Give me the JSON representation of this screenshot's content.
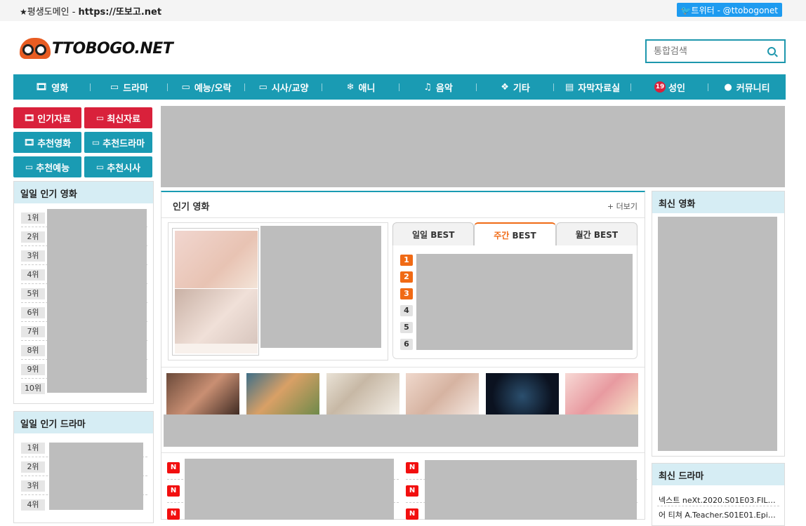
{
  "topbar": {
    "domain_label": "평생도메인 - ",
    "domain_url": "https://또보고.net",
    "twitter": "트위터 - @ttobogonet"
  },
  "header": {
    "logo_text": "TTOBOGO.NET",
    "search_placeholder": "통합검색"
  },
  "nav": {
    "items": [
      {
        "label": "영화",
        "icon": "film-icon"
      },
      {
        "label": "드라마",
        "icon": "monitor-icon"
      },
      {
        "label": "예능/오락",
        "icon": "monitor-icon"
      },
      {
        "label": "시사/교양",
        "icon": "monitor-icon"
      },
      {
        "label": "애니",
        "icon": "snowflake-icon"
      },
      {
        "label": "음악",
        "icon": "music-icon"
      },
      {
        "label": "기타",
        "icon": "cubes-icon"
      },
      {
        "label": "자막자료실",
        "icon": "document-icon"
      },
      {
        "label": "성인",
        "icon": "age-19-icon",
        "badge": "19"
      },
      {
        "label": "커뮤니티",
        "icon": "chat-icon"
      }
    ]
  },
  "quick": {
    "popular": "인기자료",
    "latest": "최신자료",
    "rec_movie": "추천영화",
    "rec_drama": "추천드라마",
    "rec_variety": "추천예능",
    "rec_current": "추천시사"
  },
  "left": {
    "daily_movie_title": "일일 인기 영화",
    "daily_drama_title": "일일 인기 드라마",
    "ranks": [
      "1위",
      "2위",
      "3위",
      "4위",
      "5위",
      "6위",
      "7위",
      "8위",
      "9위",
      "10위"
    ],
    "drama_ranks": [
      "1위",
      "2위",
      "3위",
      "4위"
    ]
  },
  "center": {
    "title": "인기 영화",
    "more": "+ 더보기",
    "tabs": [
      {
        "pre": "일일",
        "post": " BEST"
      },
      {
        "pre": "주간",
        "post": " BEST"
      },
      {
        "pre": "월간",
        "post": " BEST"
      }
    ],
    "best_numbers": [
      "1",
      "2",
      "3",
      "4",
      "5",
      "6"
    ],
    "new_badge": "N"
  },
  "right": {
    "latest_movie": "최신 영화",
    "latest_drama": "최신 드라마",
    "drama_items": [
      "넥스트 neXt.2020.S01E03.FILE.…",
      "어 티쳐 A.Teacher.S01E01.Epi…"
    ]
  },
  "colors": {
    "accent": "#1a9bb3",
    "red": "#d9213b",
    "orange": "#f06a15",
    "panel_header": "#d6edf4"
  }
}
